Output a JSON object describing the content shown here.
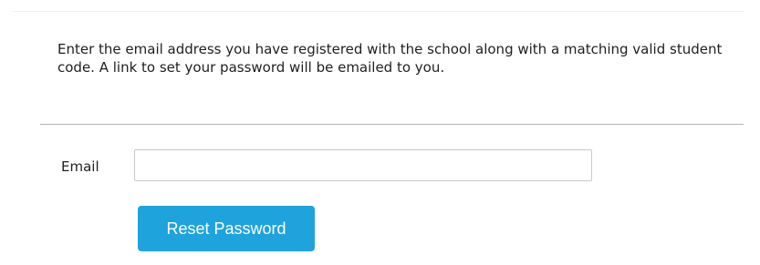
{
  "form": {
    "instructions": "Enter the email address you have registered with the school along with a matching valid student code. A link to set your password will be emailed to you.",
    "email_label": "Email",
    "email_value": "",
    "email_placeholder": "",
    "reset_button_label": "Reset Password"
  },
  "colors": {
    "button_background": "#1fa3dd",
    "button_text": "#ffffff",
    "divider": "#b3b3b3"
  }
}
